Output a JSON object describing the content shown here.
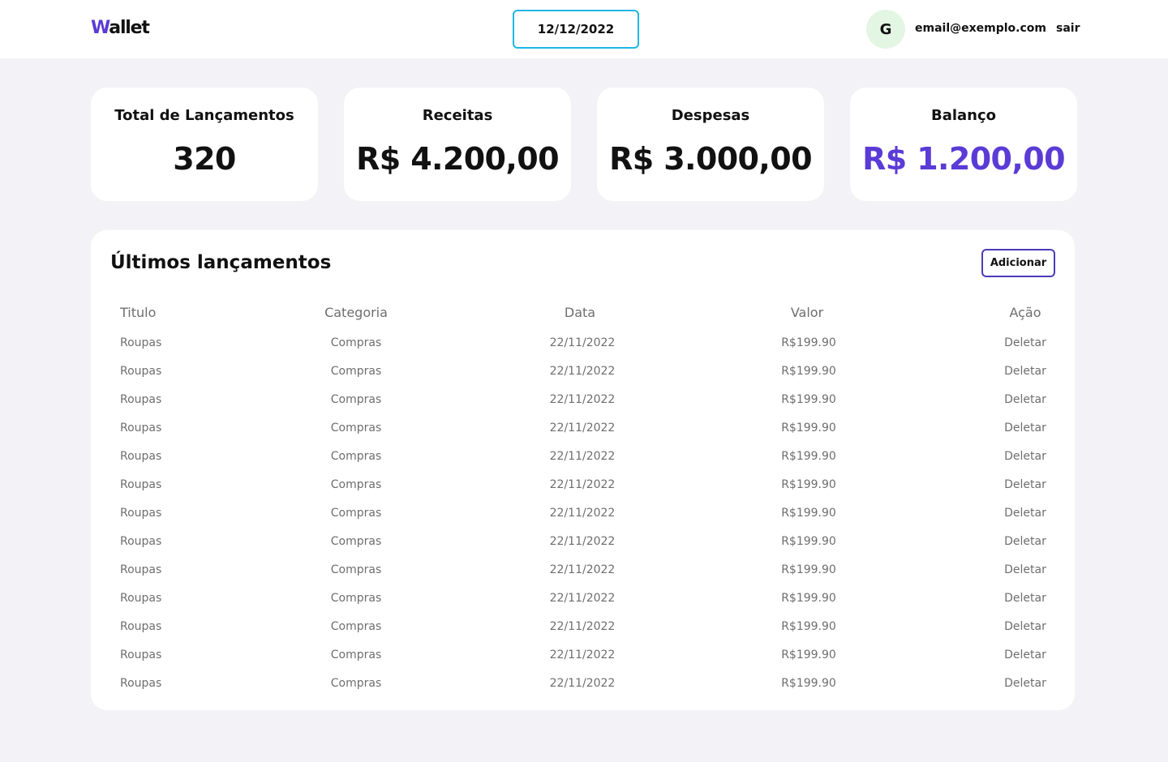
{
  "header": {
    "logo_first": "W",
    "logo_rest": "allet",
    "date": "12/12/2022",
    "avatar_initial": "G",
    "email": "email@exemplo.com",
    "logout": "sair"
  },
  "summary": {
    "total": {
      "label": "Total de Lançamentos",
      "value": "320"
    },
    "income": {
      "label": "Receitas",
      "value": "R$ 4.200,00"
    },
    "expenses": {
      "label": "Despesas",
      "value": "R$ 3.000,00"
    },
    "balance": {
      "label": "Balanço",
      "value": "R$ 1.200,00"
    }
  },
  "colors": {
    "accent": "#5B3BD6",
    "date_border": "#1FB6E6",
    "avatar_bg": "#E3F6E3",
    "page_bg": "#F3F3F7"
  },
  "transactions": {
    "title": "Últimos lançamentos",
    "add_label": "Adicionar",
    "columns": [
      "Titulo",
      "Categoria",
      "Data",
      "Valor",
      "Ação"
    ],
    "rows": [
      [
        "Roupas",
        "Compras",
        "22/11/2022",
        "R$199.90",
        "Deletar"
      ],
      [
        "Roupas",
        "Compras",
        "22/11/2022",
        "R$199.90",
        "Deletar"
      ],
      [
        "Roupas",
        "Compras",
        "22/11/2022",
        "R$199.90",
        "Deletar"
      ],
      [
        "Roupas",
        "Compras",
        "22/11/2022",
        "R$199.90",
        "Deletar"
      ],
      [
        "Roupas",
        "Compras",
        "22/11/2022",
        "R$199.90",
        "Deletar"
      ],
      [
        "Roupas",
        "Compras",
        "22/11/2022",
        "R$199.90",
        "Deletar"
      ],
      [
        "Roupas",
        "Compras",
        "22/11/2022",
        "R$199.90",
        "Deletar"
      ],
      [
        "Roupas",
        "Compras",
        "22/11/2022",
        "R$199.90",
        "Deletar"
      ],
      [
        "Roupas",
        "Compras",
        "22/11/2022",
        "R$199.90",
        "Deletar"
      ],
      [
        "Roupas",
        "Compras",
        "22/11/2022",
        "R$199.90",
        "Deletar"
      ],
      [
        "Roupas",
        "Compras",
        "22/11/2022",
        "R$199.90",
        "Deletar"
      ],
      [
        "Roupas",
        "Compras",
        "22/11/2022",
        "R$199.90",
        "Deletar"
      ],
      [
        "Roupas",
        "Compras",
        "22/11/2022",
        "R$199.90",
        "Deletar"
      ]
    ]
  }
}
